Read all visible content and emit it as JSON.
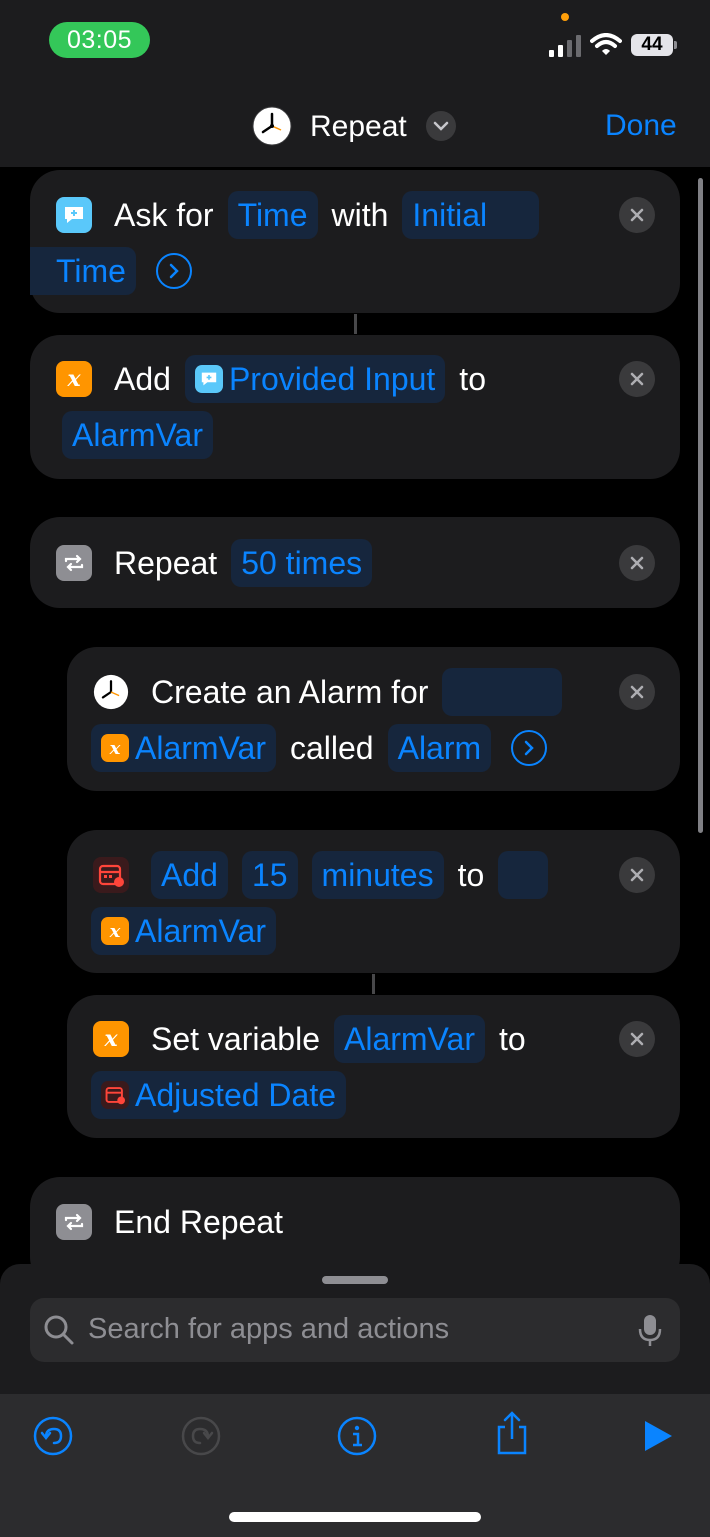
{
  "status": {
    "time": "03:05",
    "battery": "44"
  },
  "nav": {
    "title": "Repeat",
    "done_label": "Done"
  },
  "actions": {
    "ask": {
      "label": "Ask for",
      "type_token": "Time",
      "with_label": "with",
      "initial_token_1": "Initial",
      "initial_token_2": "Time"
    },
    "add_var": {
      "label": "Add",
      "input_token": "Provided Input",
      "to_label": "to",
      "var_token": "AlarmVar"
    },
    "repeat": {
      "label": "Repeat",
      "count_token": "50 times"
    },
    "alarm": {
      "label": "Create an Alarm for",
      "var_token": "AlarmVar",
      "called_label": "called",
      "name_token": "Alarm"
    },
    "adjust": {
      "add_token": "Add",
      "amount_token": "15",
      "unit_token": "minutes",
      "to_label": "to",
      "var_token": "AlarmVar"
    },
    "set_var": {
      "label": "Set variable",
      "var_token": "AlarmVar",
      "to_label": "to",
      "value_token": "Adjusted Date"
    },
    "end_repeat": {
      "label": "End Repeat"
    }
  },
  "search": {
    "placeholder": "Search for apps and actions"
  },
  "icons": {
    "ask": "ask-for-input-icon",
    "variable": "variable-icon",
    "repeat": "repeat-icon",
    "clock": "clock-icon",
    "calendar": "calendar-adjust-icon",
    "undo": "undo-icon",
    "redo": "redo-icon",
    "info": "info-icon",
    "share": "share-icon",
    "play": "play-icon"
  },
  "colors": {
    "accent": "#0a84ff",
    "status_green": "#34c759",
    "variable_orange": "#ff9500",
    "ask_cyan": "#5ac8fa",
    "card_bg": "#1c1c1e"
  }
}
